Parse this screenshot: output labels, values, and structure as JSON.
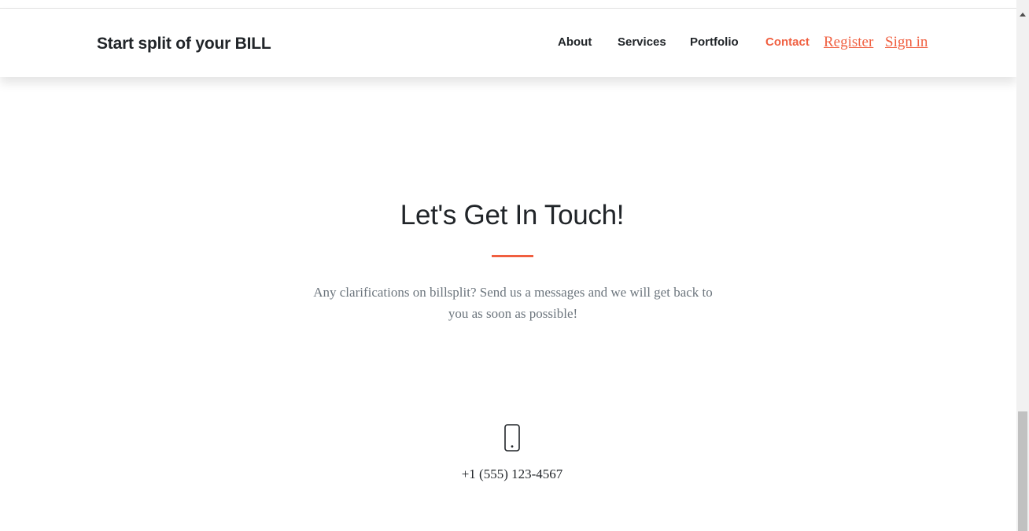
{
  "navbar": {
    "brand": "Start split of your BILL",
    "links": [
      {
        "label": "About",
        "active": false
      },
      {
        "label": "Services",
        "active": false
      },
      {
        "label": "Portfolio",
        "active": false
      },
      {
        "label": "Contact",
        "active": true
      }
    ],
    "register_label": "Register",
    "signin_label": "Sign in"
  },
  "contact": {
    "heading": "Let's Get In Touch!",
    "lead": "Any clarifications on billsplit? Send us a messages and we will get back to you as soon as possible!",
    "phone_icon": "mobile-phone-icon",
    "phone": "+1 (555) 123-4567"
  },
  "colors": {
    "accent": "#f05f40",
    "text": "#212529",
    "muted": "#6c757d"
  }
}
